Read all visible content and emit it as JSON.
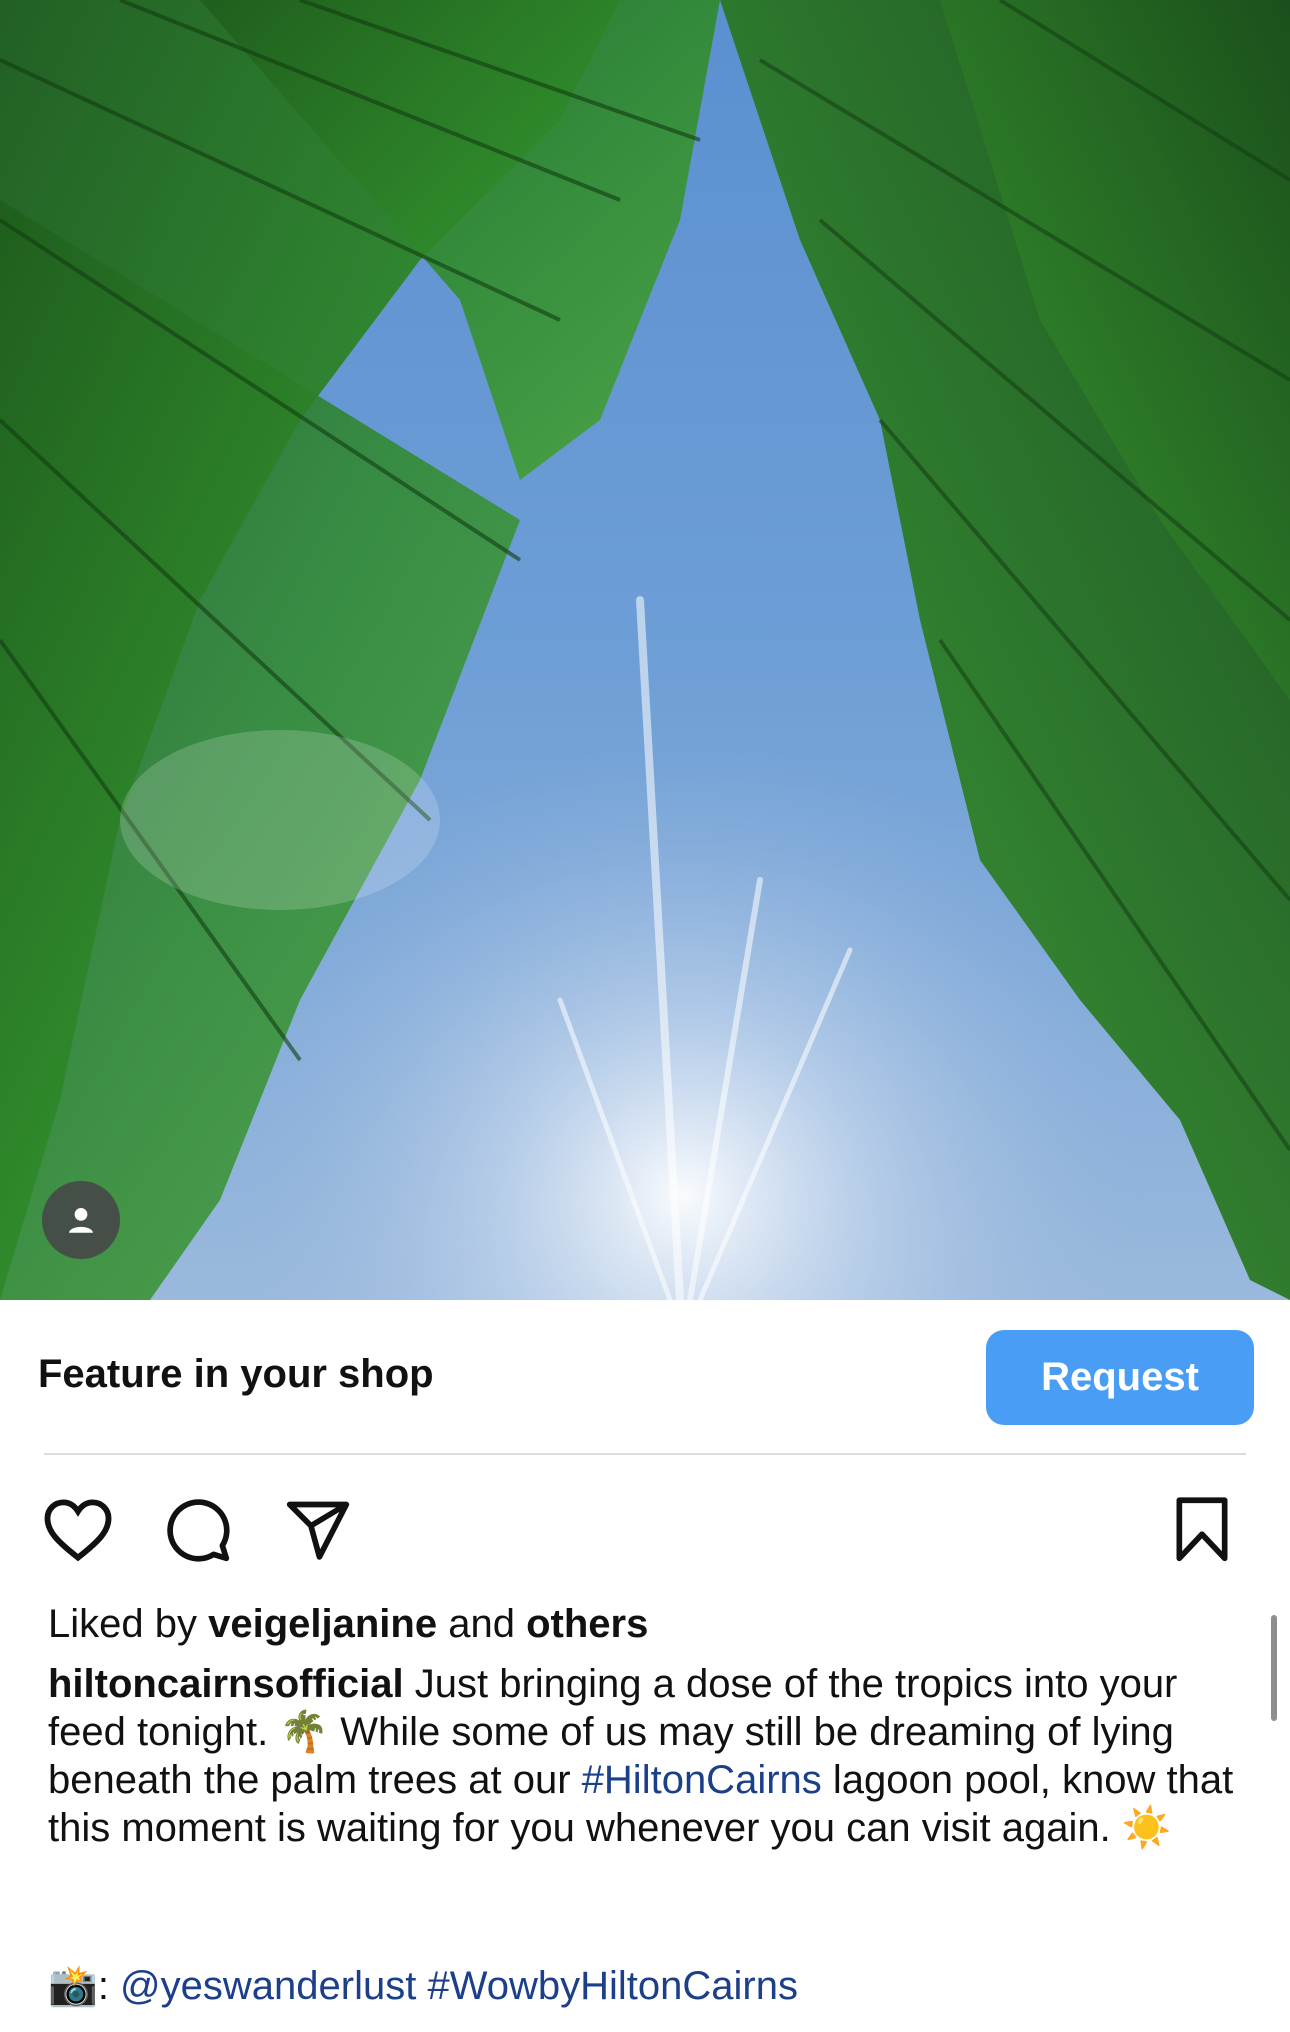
{
  "post": {
    "image_description_icon": "user-tag-icon",
    "shop": {
      "title": "Feature in your shop",
      "button": "Request"
    },
    "actions": [
      "heart-icon",
      "comment-icon",
      "share-icon",
      "bookmark-icon"
    ],
    "likes": {
      "prefix": "Liked by ",
      "user": "veigeljanine",
      "middle": " and ",
      "others": "others"
    },
    "caption": {
      "username": "hiltoncairnsofficial",
      "text1": " Just bringing a dose of the tropics into your feed tonight. ",
      "emoji1": "🌴",
      "text2": " While some of us may still be dreaming of lying beneath the palm trees at our ",
      "hashtag1": "#HiltonCairns",
      "text3": " lagoon pool, know that this moment is waiting for you whenever you can visit again. ",
      "emoji2": "☀️"
    },
    "credit": {
      "emoji": "📸",
      "sep": ": ",
      "mention": "@yeswanderlust",
      "hashtag": "#WowbyHiltonCairns"
    }
  },
  "colors": {
    "accent": "#4a9df5",
    "link": "#1c3f8a"
  }
}
